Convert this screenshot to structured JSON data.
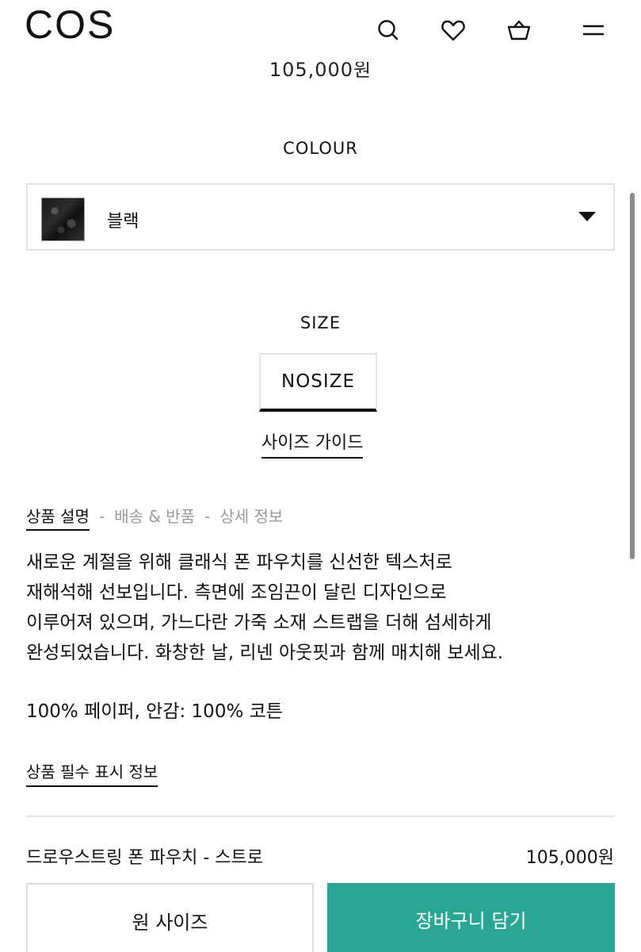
{
  "header": {
    "logo": "COS",
    "icons": [
      "search-icon",
      "heart-icon",
      "basket-icon",
      "menu-icon"
    ]
  },
  "price_top": "105,000원",
  "colour": {
    "label": "COLOUR",
    "selected": "블랙"
  },
  "size": {
    "label": "SIZE",
    "option": "NOSIZE",
    "guide_link": "사이즈 가이드"
  },
  "tabs": {
    "description": "상품 설명",
    "separator": "-",
    "shipping": "배송 & 반품",
    "details": "상세 정보"
  },
  "description": {
    "line1": "새로운 계절을 위해 클래식 폰 파우치를 신선한 텍스처로",
    "line2": "재해석해 선보입니다. 측면에 조임끈이 달린 디자인으로",
    "line3": "이루어져 있으며, 가느다란 가죽 소재 스트랩을 더해 섬세하게",
    "line4": "완성되었습니다. 화창한 날, 리넨 아웃핏과 함께 매치해 보세요.",
    "material": "100% 페이퍼, 안감: 100% 코튼"
  },
  "notice_link": "상품 필수 표시 정보",
  "sticky_bar": {
    "product_name": "드로우스트링 폰 파우치 - 스트로",
    "price": "105,000원",
    "size_button": "원 사이즈",
    "add_to_cart": "장바구니 담기"
  },
  "colors": {
    "accent": "#2aa695",
    "text": "#111111",
    "muted": "#999999",
    "border": "#e2e2e2"
  }
}
